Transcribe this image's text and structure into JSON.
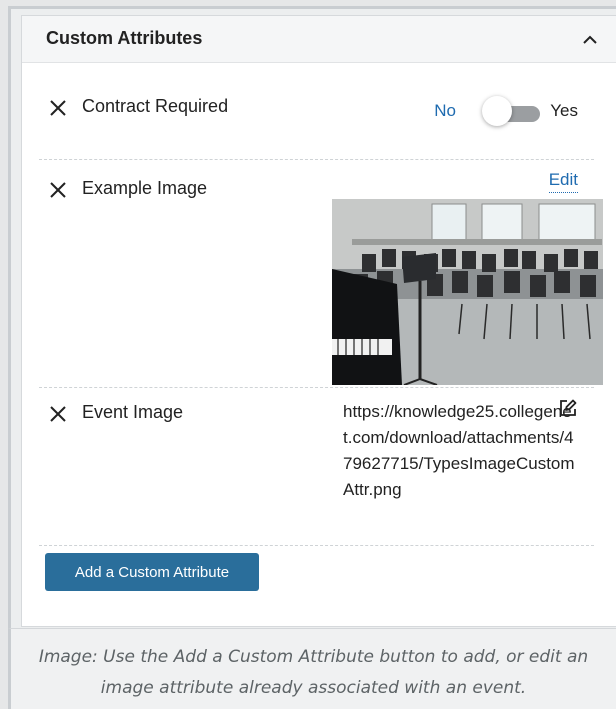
{
  "panel": {
    "title": "Custom Attributes"
  },
  "attributes": [
    {
      "label": "Contract Required",
      "toggle_no": "No",
      "toggle_yes": "Yes",
      "value": false
    },
    {
      "label": "Example Image",
      "edit_label": "Edit"
    },
    {
      "label": "Event Image",
      "url": "https://knowledge25.collegenet.com/download/attachments/479627715/TypesImageCustomAttr.png"
    }
  ],
  "add_button_label": "Add a Custom Attribute",
  "caption": "Image: Use the Add a Custom Attribute button to add, or edit an image attribute already associated with an event.",
  "colors": {
    "accent": "#1f6bb0",
    "button": "#2a6e9b"
  }
}
